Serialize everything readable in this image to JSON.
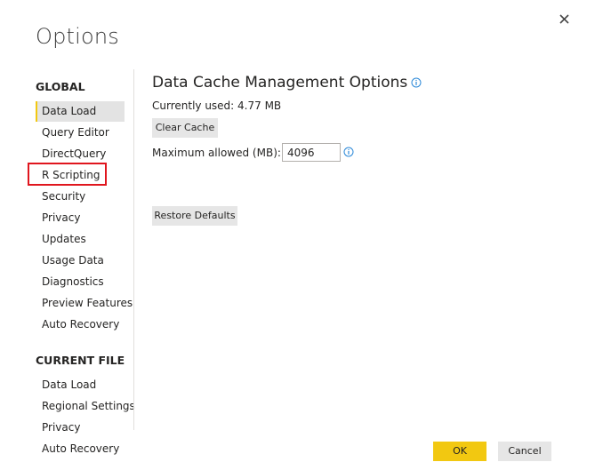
{
  "dialog": {
    "title": "Options"
  },
  "sidebar": {
    "global_header": "GLOBAL",
    "global_items": [
      {
        "label": "Data Load",
        "active": true
      },
      {
        "label": "Query Editor"
      },
      {
        "label": "DirectQuery"
      },
      {
        "label": "R Scripting",
        "highlighted": true
      },
      {
        "label": "Security"
      },
      {
        "label": "Privacy"
      },
      {
        "label": "Updates"
      },
      {
        "label": "Usage Data"
      },
      {
        "label": "Diagnostics"
      },
      {
        "label": "Preview Features"
      },
      {
        "label": "Auto Recovery"
      }
    ],
    "current_file_header": "CURRENT FILE",
    "current_file_items": [
      {
        "label": "Data Load"
      },
      {
        "label": "Regional Settings"
      },
      {
        "label": "Privacy"
      },
      {
        "label": "Auto Recovery"
      }
    ]
  },
  "main": {
    "title": "Data Cache Management Options",
    "currently_used": "Currently used: 4.77 MB",
    "clear_cache_label": "Clear Cache",
    "maximum_allowed_label": "Maximum allowed (MB):",
    "maximum_allowed_value": "4096",
    "restore_defaults_label": "Restore Defaults"
  },
  "footer": {
    "ok_label": "OK",
    "cancel_label": "Cancel"
  },
  "colors": {
    "accent": "#f2c811",
    "highlight_box": "#e0161e",
    "info_icon": "#2b88d8"
  },
  "icons": {
    "close": "close-icon",
    "info": "info-icon"
  }
}
